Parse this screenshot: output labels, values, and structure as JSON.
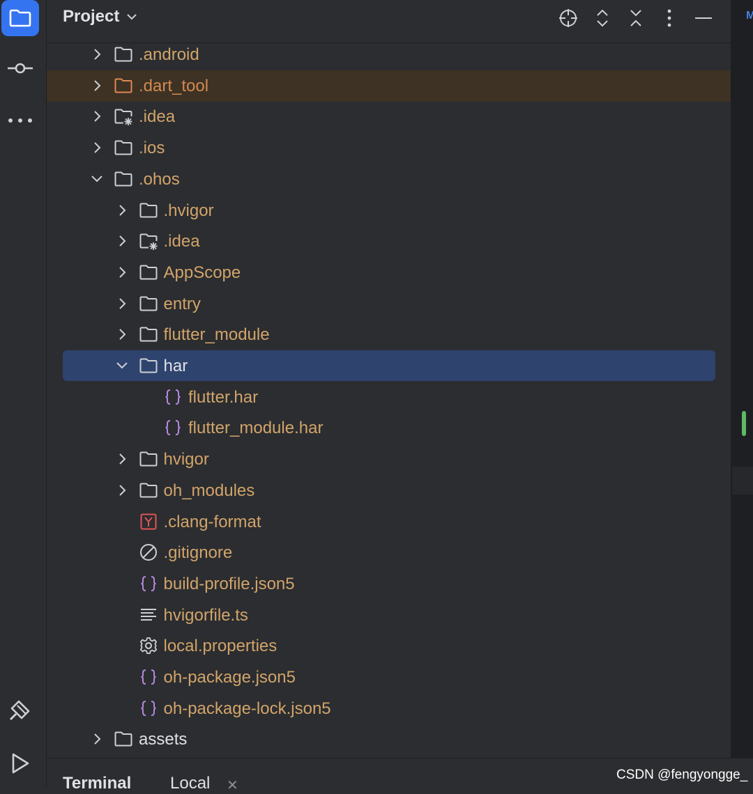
{
  "panel": {
    "title": "Project"
  },
  "tree": [
    {
      "label": ".android",
      "icon": "folder-icon",
      "expanded": false,
      "depth": 0,
      "hasChevron": true,
      "color": "orange"
    },
    {
      "label": ".dart_tool",
      "icon": "folder-excluded-icon",
      "expanded": false,
      "depth": 0,
      "hasChevron": true,
      "color": "dart",
      "highlight": "warn"
    },
    {
      "label": ".idea",
      "icon": "folder-settings-icon",
      "expanded": false,
      "depth": 0,
      "hasChevron": true,
      "color": "orange"
    },
    {
      "label": ".ios",
      "icon": "folder-icon",
      "expanded": false,
      "depth": 0,
      "hasChevron": true,
      "color": "orange"
    },
    {
      "label": ".ohos",
      "icon": "folder-icon",
      "expanded": true,
      "depth": 0,
      "hasChevron": true,
      "color": "orange"
    },
    {
      "label": ".hvigor",
      "icon": "folder-icon",
      "expanded": false,
      "depth": 1,
      "hasChevron": true,
      "color": "orange"
    },
    {
      "label": ".idea",
      "icon": "folder-settings-icon",
      "expanded": false,
      "depth": 1,
      "hasChevron": true,
      "color": "orange"
    },
    {
      "label": "AppScope",
      "icon": "folder-icon",
      "expanded": false,
      "depth": 1,
      "hasChevron": true,
      "color": "orange"
    },
    {
      "label": "entry",
      "icon": "folder-icon",
      "expanded": false,
      "depth": 1,
      "hasChevron": true,
      "color": "orange"
    },
    {
      "label": "flutter_module",
      "icon": "folder-icon",
      "expanded": false,
      "depth": 1,
      "hasChevron": true,
      "color": "orange"
    },
    {
      "label": "har",
      "icon": "folder-icon",
      "expanded": true,
      "depth": 1,
      "hasChevron": true,
      "color": "normal",
      "highlight": "selected"
    },
    {
      "label": "flutter.har",
      "icon": "json-braces-icon",
      "depth": 2,
      "hasChevron": false,
      "color": "orange"
    },
    {
      "label": "flutter_module.har",
      "icon": "json-braces-icon",
      "depth": 2,
      "hasChevron": false,
      "color": "orange"
    },
    {
      "label": "hvigor",
      "icon": "folder-icon",
      "expanded": false,
      "depth": 1,
      "hasChevron": true,
      "color": "orange"
    },
    {
      "label": "oh_modules",
      "icon": "folder-icon",
      "expanded": false,
      "depth": 1,
      "hasChevron": true,
      "color": "orange"
    },
    {
      "label": ".clang-format",
      "icon": "yaml-icon",
      "depth": 1,
      "hasChevron": false,
      "color": "orange"
    },
    {
      "label": ".gitignore",
      "icon": "ignore-icon",
      "depth": 1,
      "hasChevron": false,
      "color": "orange"
    },
    {
      "label": "build-profile.json5",
      "icon": "json-braces-icon",
      "depth": 1,
      "hasChevron": false,
      "color": "orange"
    },
    {
      "label": "hvigorfile.ts",
      "icon": "text-lines-icon",
      "depth": 1,
      "hasChevron": false,
      "color": "orange"
    },
    {
      "label": "local.properties",
      "icon": "gear-icon",
      "depth": 1,
      "hasChevron": false,
      "color": "orange"
    },
    {
      "label": "oh-package.json5",
      "icon": "json-braces-icon",
      "depth": 1,
      "hasChevron": false,
      "color": "orange"
    },
    {
      "label": "oh-package-lock.json5",
      "icon": "json-braces-icon",
      "depth": 1,
      "hasChevron": false,
      "color": "orange"
    },
    {
      "label": "assets",
      "icon": "folder-icon",
      "expanded": false,
      "depth": 0,
      "hasChevron": true,
      "color": "normal"
    }
  ],
  "bottom": {
    "terminal_label": "Terminal",
    "local_label": "Local"
  },
  "watermark": "CSDN @fengyongge_",
  "editor_tab_letter": "M",
  "colors": {
    "accent": "#3574f0",
    "selection": "#2e436e",
    "warn_row": "#3d3223",
    "modified_text": "#d2a46a",
    "json_icon": "#b589e0",
    "yaml_icon": "#e05555",
    "change_marker": "#5fb865"
  }
}
